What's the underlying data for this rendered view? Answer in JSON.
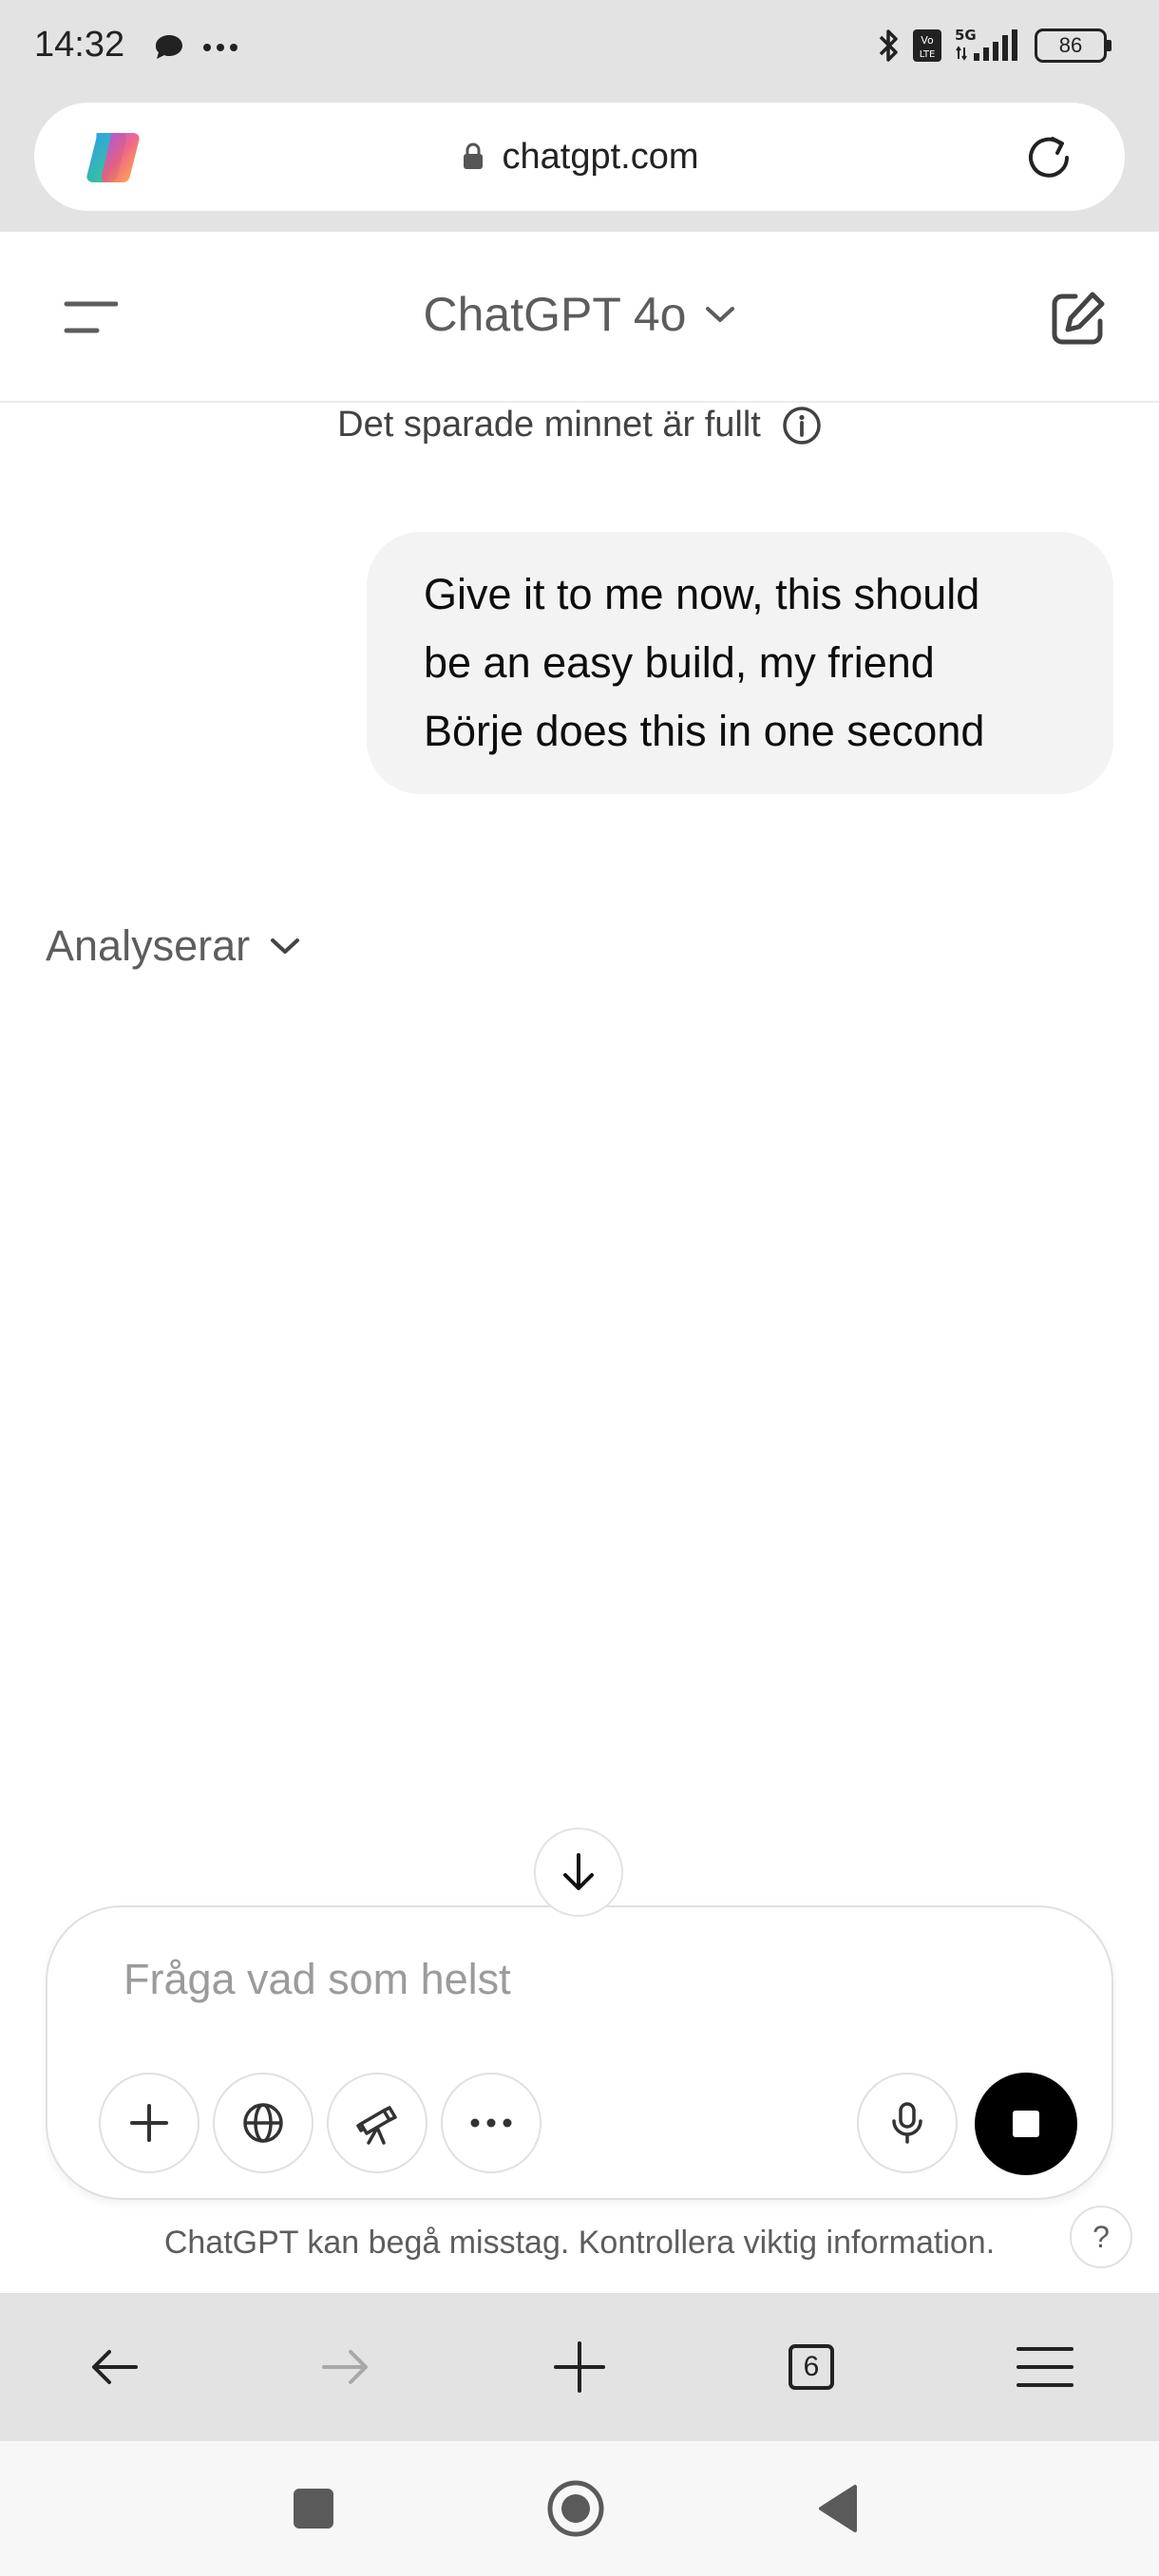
{
  "status_bar": {
    "time": "14:32",
    "battery_level": "86",
    "icons": [
      "chat-bubble-icon",
      "more-dots-icon",
      "bluetooth-icon",
      "volte-icon",
      "5g-signal-icon",
      "battery-icon"
    ]
  },
  "browser": {
    "url": "chatgpt.com",
    "tab_count": "6",
    "icons": [
      "copilot-logo-icon",
      "lock-icon",
      "reload-icon",
      "back-arrow-icon",
      "forward-arrow-icon",
      "new-tab-plus-icon",
      "tab-switcher-icon",
      "menu-icon"
    ]
  },
  "header": {
    "model_name": "ChatGPT 4o"
  },
  "memory_notice": "Det sparade minnet är fullt",
  "conversation": {
    "user_message_lines": [
      "Give it to me now, this should",
      "be an easy build, my friend",
      "Börje does this in one second"
    ],
    "status_label": "Analyserar"
  },
  "composer": {
    "placeholder": "Fråga vad som helst",
    "value": ""
  },
  "disclaimer": "ChatGPT kan begå misstag. Kontrollera viktig information.",
  "help_label": "?",
  "colors": {
    "chrome_gray": "#e3e3e3",
    "bubble_gray": "#f3f3f3",
    "stop_button": "#000000"
  }
}
